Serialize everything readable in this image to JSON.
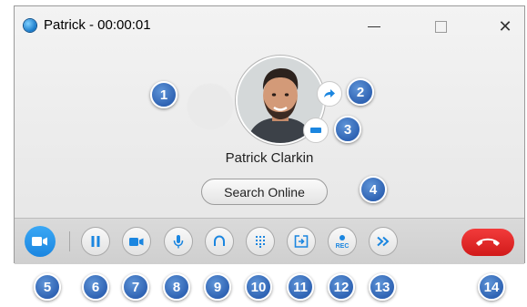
{
  "window": {
    "title": "Patrick - 00:00:01",
    "close_symbol": "✕"
  },
  "caller": {
    "name": "Patrick Clarkin",
    "search_online_label": "Search Online"
  },
  "toolbar": {
    "record_label": "REC"
  },
  "colors": {
    "accent_blue": "#1b86e0",
    "hangup_red": "#d11a1a",
    "badge_blue": "#2f63b3"
  },
  "icons": [
    "app-logo-icon",
    "minimize-icon",
    "maximize-icon",
    "close-icon",
    "transfer-icon",
    "identity-icon",
    "video-icon",
    "pause-icon",
    "video-camera-icon",
    "microphone-icon",
    "headset-icon",
    "dialpad-icon",
    "screen-share-icon",
    "record-icon",
    "forward-icon",
    "hangup-icon"
  ],
  "badges": [
    "1",
    "2",
    "3",
    "4",
    "5",
    "6",
    "7",
    "8",
    "9",
    "10",
    "11",
    "12",
    "13",
    "14"
  ]
}
